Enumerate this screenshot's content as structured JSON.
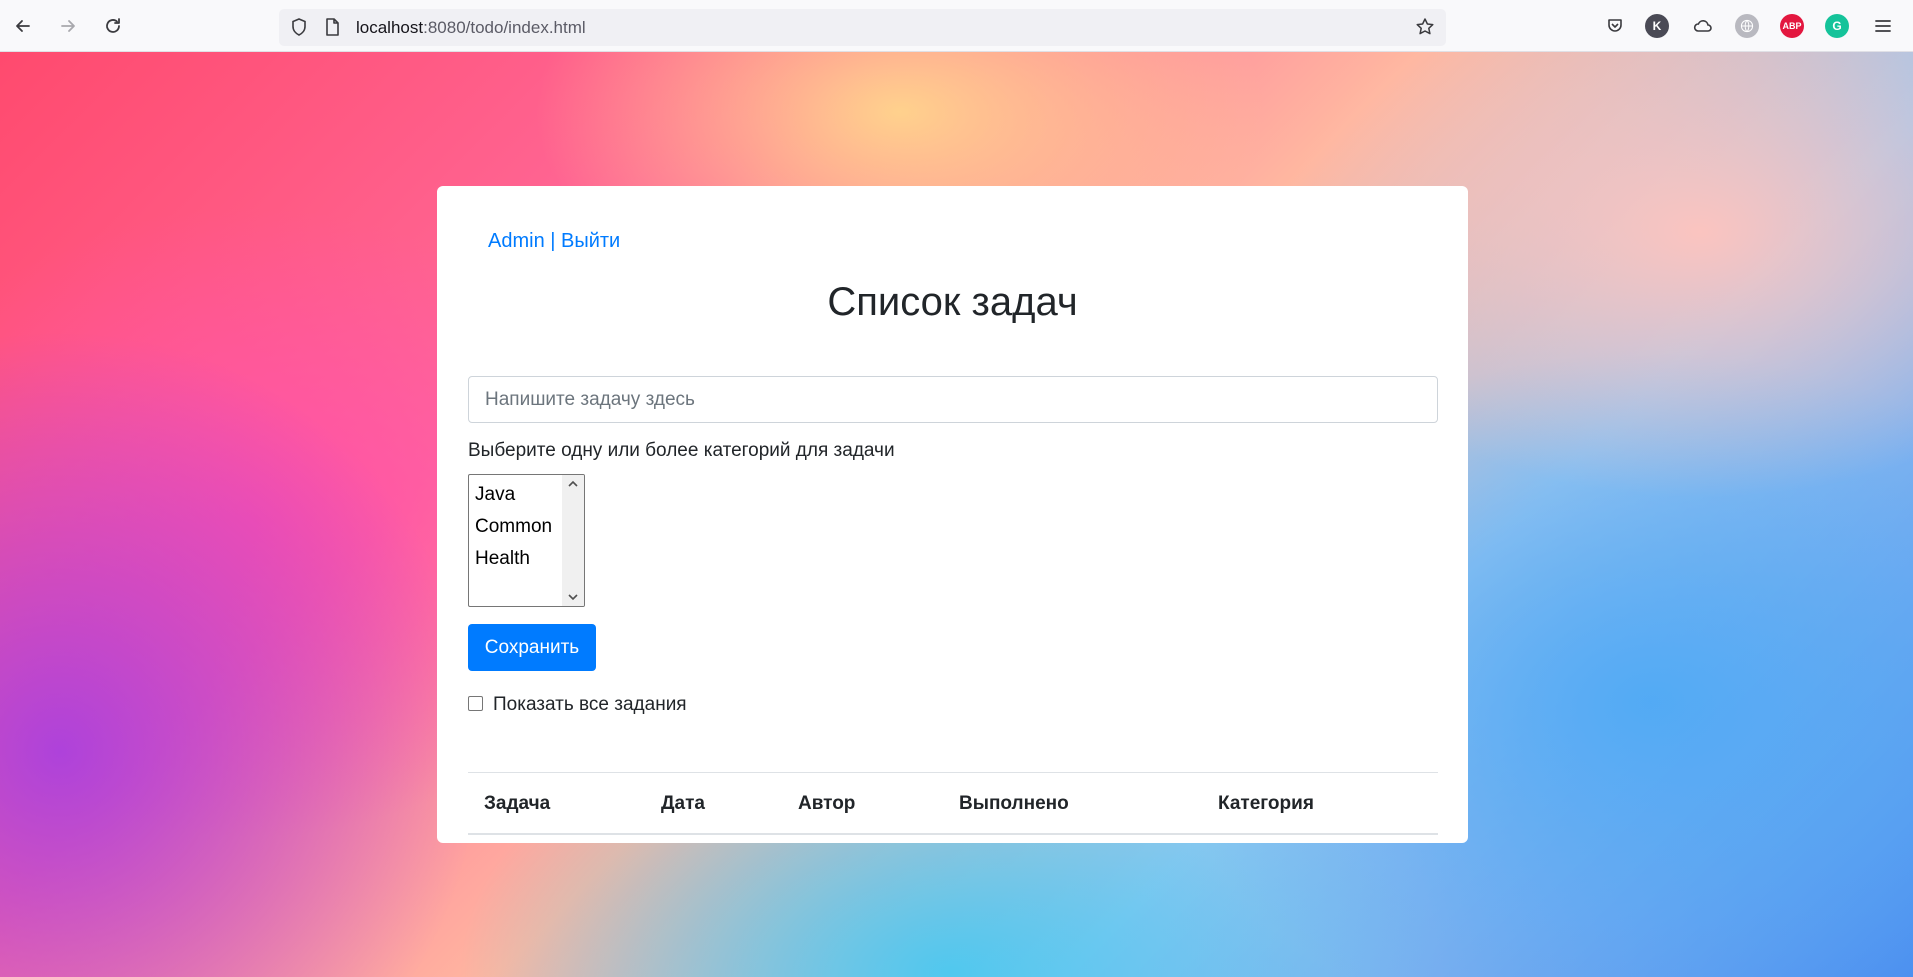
{
  "browser": {
    "url_host": "localhost",
    "url_rest": ":8080/todo/index.html",
    "extensions": [
      {
        "name": "pocket-icon"
      },
      {
        "name": "k-extension-icon",
        "letter": "K",
        "color": "#4a4a55"
      },
      {
        "name": "cloud-icon"
      },
      {
        "name": "globe-icon",
        "color": "#b9b9c0"
      },
      {
        "name": "adblock-icon",
        "letter": "ABP",
        "color": "#e3173f"
      },
      {
        "name": "grammarly-icon",
        "letter": "G",
        "color": "#15c39a"
      }
    ]
  },
  "header": {
    "user_link": "Admin | Выйти",
    "title": "Список задач"
  },
  "form": {
    "task_placeholder": "Напишите задачу здесь",
    "category_label": "Выберите одну или более категорий для задачи",
    "categories": [
      "Java",
      "Common",
      "Health"
    ],
    "save_label": "Сохранить",
    "show_all_label": "Показать все задания",
    "show_all_checked": false
  },
  "table": {
    "columns": [
      "Задача",
      "Дата",
      "Автор",
      "Выполнено",
      "Категория"
    ],
    "rows": []
  },
  "colors": {
    "primary": "#007bff",
    "text": "#212529"
  }
}
